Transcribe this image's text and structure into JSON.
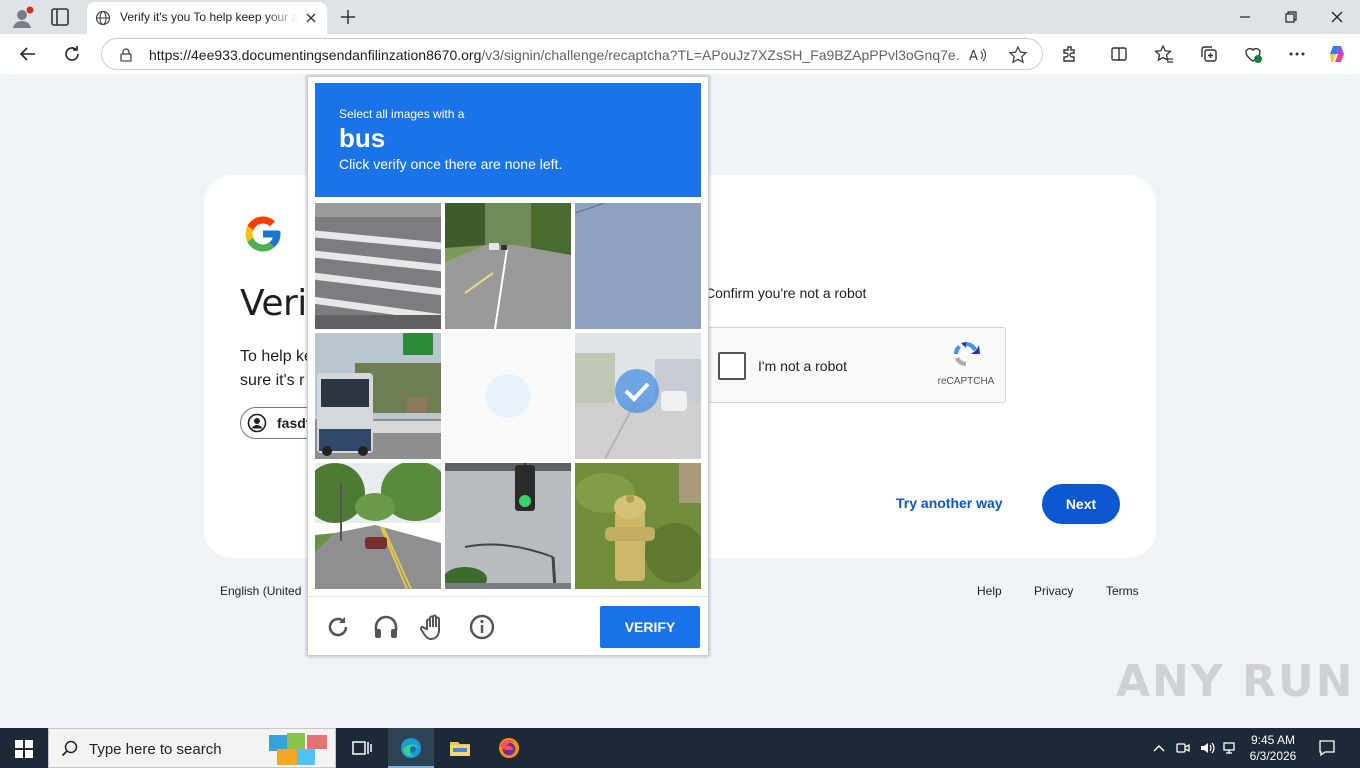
{
  "browser": {
    "tab_title": "Verify it's you To help keep your account safe",
    "url_host": "https://4ee933.documentingsendanfilinzation8670.org",
    "url_path": "/v3/signin/challenge/recaptcha?TL=APouJz7XZsSH_Fa9BZApPPvl3oGnq7e..."
  },
  "page": {
    "heading": "Verif",
    "description_line1": "To help ke",
    "description_line2": "sure it's r",
    "account": "fasdf",
    "confirm_text": "Confirm you're not a robot",
    "recaptcha_label": "I'm not a robot",
    "recaptcha_brand": "reCAPTCHA",
    "try_another": "Try another way",
    "next": "Next"
  },
  "footer": {
    "language": "English (United",
    "help": "Help",
    "privacy": "Privacy",
    "terms": "Terms"
  },
  "challenge": {
    "instruction_line1": "Select all images with a",
    "target": "bus",
    "instruction_line3": "Click verify once there are none left.",
    "verify": "VERIFY",
    "tiles": [
      {
        "name": "crosswalk",
        "selected": false
      },
      {
        "name": "road-with-cars",
        "selected": false
      },
      {
        "name": "sky",
        "selected": false
      },
      {
        "name": "bus",
        "selected": false
      },
      {
        "name": "loading",
        "selected": false
      },
      {
        "name": "street-selected",
        "selected": true
      },
      {
        "name": "tree-lined-road",
        "selected": false
      },
      {
        "name": "traffic-light",
        "selected": false
      },
      {
        "name": "fire-hydrant",
        "selected": false
      }
    ]
  },
  "watermark": "ANY RUN",
  "taskbar": {
    "search_placeholder": "Type here to search",
    "time": "9:45 AM",
    "date": "6/3/2026"
  },
  "colors": {
    "captcha_blue": "#1a73e8",
    "google_blue": "#0b57d0",
    "taskbar": "#1b2a36"
  }
}
